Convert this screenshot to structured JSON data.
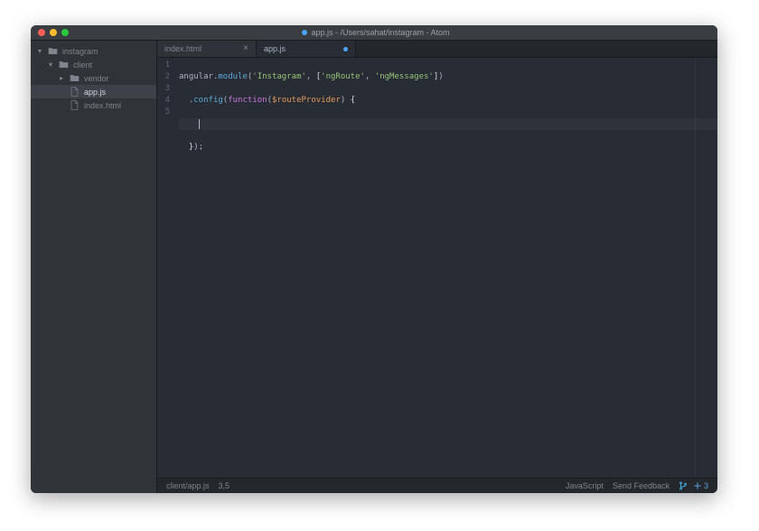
{
  "window": {
    "title": "app.js - /Users/sahat/instagram - Atom",
    "modified": true
  },
  "tree": {
    "root": {
      "label": "instagram",
      "expanded": true
    },
    "client": {
      "label": "client",
      "expanded": true
    },
    "vendor": {
      "label": "vendor",
      "expanded": false
    },
    "app_js": {
      "label": "app.js"
    },
    "index_html": {
      "label": "index.html"
    }
  },
  "tabs": [
    {
      "label": "index.html",
      "active": false,
      "modified": false
    },
    {
      "label": "app.js",
      "active": true,
      "modified": true
    }
  ],
  "code": {
    "l1": {
      "angular": "angular",
      "dot1": ".",
      "module": "module",
      "op": "(",
      "s1": "'Instagram'",
      "comma1": ", ",
      "lb": "[",
      "s2": "'ngRoute'",
      "comma2": ", ",
      "s3": "'ngMessages'",
      "rb": "]",
      "cp": ")"
    },
    "l2": {
      "indent": "  ",
      "dot": ".",
      "config": "config",
      "op": "(",
      "kw": "function",
      "op2": "(",
      "param": "$routeProvider",
      "cp2": ")",
      "sp": " ",
      "brace": "{"
    },
    "l3": {
      "indent": ""
    },
    "l4": {
      "indent": "  ",
      "brace": "}",
      "cp": ")",
      "semi": ";"
    }
  },
  "gutter": [
    "1",
    "2",
    "3",
    "4",
    "5"
  ],
  "status": {
    "path": "client/app.js",
    "cursor": "3,5",
    "lang": "JavaScript",
    "feedback": "Send Feedback",
    "git_changes": "3"
  },
  "colors": {
    "accent": "#4aa5ff"
  }
}
